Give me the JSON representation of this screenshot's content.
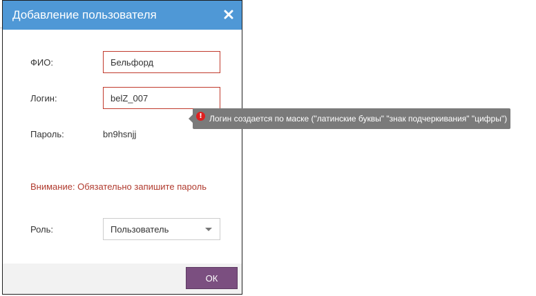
{
  "dialog": {
    "title": "Добавление пользователя",
    "close_icon": "close-icon"
  },
  "form": {
    "fio_label": "ФИО:",
    "fio_value": "Бельфорд",
    "login_label": "Логин:",
    "login_value": "belZ_007",
    "password_label": "Пароль:",
    "password_value": "bn9hsnjj",
    "warning": "Внимание: Обязательно запишите пароль",
    "role_label": "Роль:",
    "role_value": "Пользователь"
  },
  "tooltip": {
    "icon": "error-icon",
    "icon_glyph": "!",
    "text": "Логин создается по маске (\"латинские буквы\" \"знак подчеркивания\" \"цифры\")"
  },
  "footer": {
    "ok_label": "ОК"
  },
  "colors": {
    "header": "#4f98d6",
    "error_border": "#c0392b",
    "warning_text": "#b03a2e",
    "ok_button": "#7b4f80",
    "tooltip_bg": "#7a7a7a",
    "tooltip_icon": "#e02020"
  }
}
